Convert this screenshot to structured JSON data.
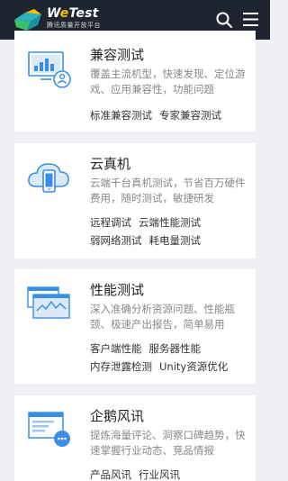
{
  "header": {
    "brand_name_pre": "W",
    "brand_name_e": "e",
    "brand_name_post": "Test",
    "brand_sub": "腾讯质量开放平台",
    "search_icon": "search-icon",
    "menu_icon": "menu-icon",
    "accent_color": "#f5c400",
    "bg_color": "#1f2530"
  },
  "cards": [
    {
      "title": "兼容测试",
      "desc": "覆盖主流机型，快速发现、定位游戏、应用兼容性，功能问题",
      "links": [
        "标准兼容测试",
        "专家兼容测试"
      ],
      "icon": "compatibility-monitor-icon"
    },
    {
      "title": "云真机",
      "desc": "云端千台真机测试，节省百万硬件费用，随时测试，敏捷研发",
      "links": [
        "远程调试",
        "云端性能测试",
        "弱网络测试",
        "耗电量测试"
      ],
      "icon": "cloud-phone-icon"
    },
    {
      "title": "性能测试",
      "desc": "深入准确分析资源问题、性能瓶颈、极速产出报告，简单易用",
      "links": [
        "客户端性能",
        "服务器性能",
        "内存泄露检测",
        "Unity资源优化"
      ],
      "icon": "performance-chart-icon"
    },
    {
      "title": "企鹅风讯",
      "desc": "提炼海量评论、洞察口碑趋势，快速掌握行业动态、竞品情报",
      "links": [
        "产品风讯",
        "行业风讯"
      ],
      "icon": "feedback-window-icon"
    }
  ],
  "colors": {
    "icon_blue": "#3a8ee6",
    "page_bg": "#eef0f3"
  }
}
